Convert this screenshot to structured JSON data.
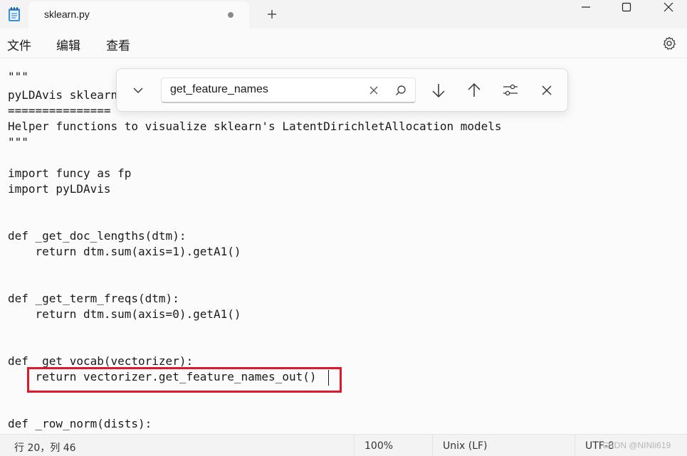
{
  "tab": {
    "title": "sklearn.py"
  },
  "menu": {
    "file": "文件",
    "edit": "编辑",
    "view": "查看"
  },
  "find": {
    "query": "get_feature_names"
  },
  "code": {
    "lines": [
      "\"\"\"",
      "pyLDAvis sklearn",
      "===============",
      "Helper functions to visualize sklearn's LatentDirichletAllocation models",
      "\"\"\"",
      "",
      "import funcy as fp",
      "import pyLDAvis",
      "",
      "",
      "def _get_doc_lengths(dtm):",
      "    return dtm.sum(axis=1).getA1()",
      "",
      "",
      "def _get_term_freqs(dtm):",
      "    return dtm.sum(axis=0).getA1()",
      "",
      "",
      "def _get_vocab(vectorizer):",
      "    return vectorizer.get_feature_names_out()",
      "",
      "",
      "def _row_norm(dists):"
    ]
  },
  "status": {
    "position": "行 20，列 46",
    "zoom": "100%",
    "line_ending": "Unix (LF)",
    "encoding": "UTF-8",
    "watermark": "CSDN @NINIi619"
  },
  "colors": {
    "highlight": "#e0182b",
    "accent": "#0067c0"
  }
}
